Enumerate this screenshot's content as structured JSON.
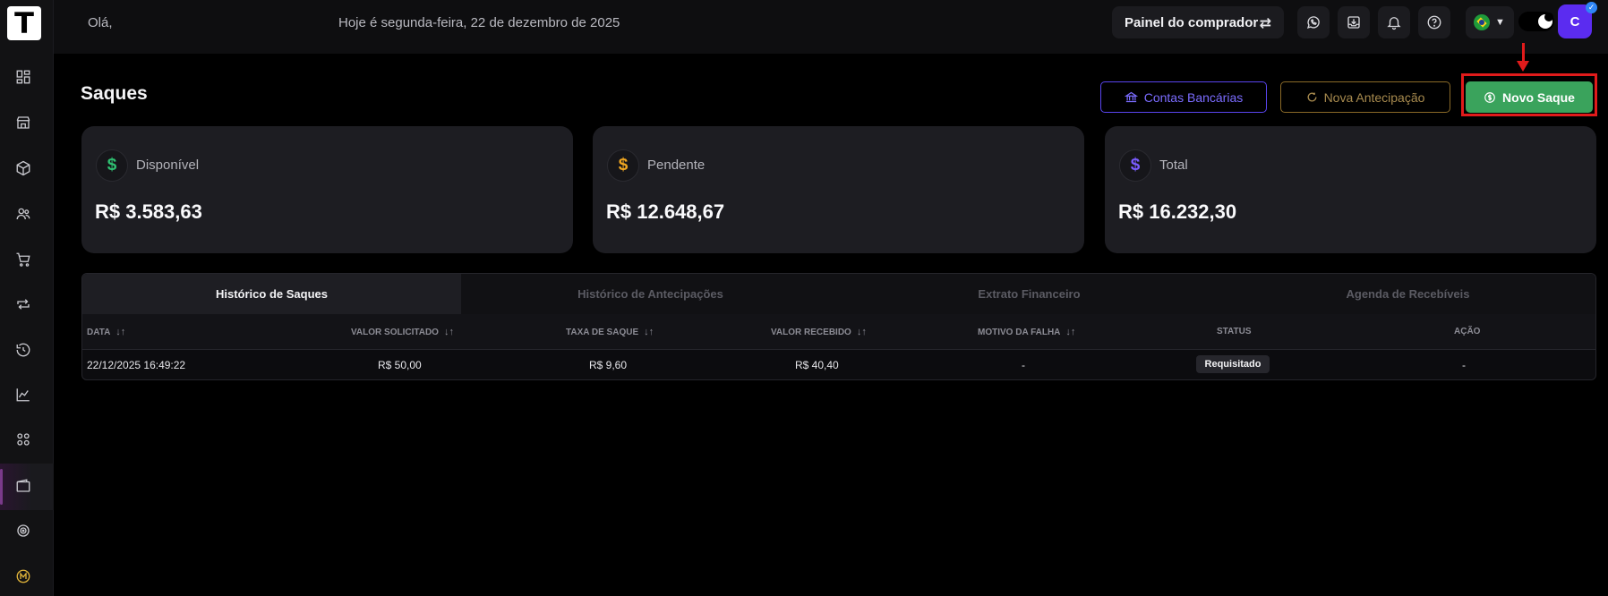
{
  "app": {
    "logo_letter": "T"
  },
  "topbar": {
    "greeting": "Olá,",
    "date_text": "Hoje é segunda-feira, 22 de dezembro de 2025",
    "buyer_panel_label": "Painel do comprador",
    "avatar_initial": "C"
  },
  "page": {
    "title": "Saques",
    "buttons": {
      "bank_accounts": "Contas Bancárias",
      "new_advance": "Nova Antecipação",
      "new_withdrawal": "Novo Saque"
    }
  },
  "cards": [
    {
      "label": "Disponível",
      "value": "R$ 3.583,63",
      "icon": "dollar-icon",
      "color": "#2fbf71"
    },
    {
      "label": "Pendente",
      "value": "R$ 12.648,67",
      "icon": "dollar-icon",
      "color": "#f0a621"
    },
    {
      "label": "Total",
      "value": "R$ 16.232,30",
      "icon": "dollar-icon",
      "color": "#7a5cff"
    }
  ],
  "tabs": [
    {
      "label": "Histórico de Saques",
      "active": true
    },
    {
      "label": "Histórico de Antecipações",
      "active": false
    },
    {
      "label": "Extrato Financeiro",
      "active": false
    },
    {
      "label": "Agenda de Recebíveis",
      "active": false
    }
  ],
  "table": {
    "columns": [
      "DATA",
      "VALOR SOLICITADO",
      "TAXA DE SAQUE",
      "VALOR RECEBIDO",
      "MOTIVO DA FALHA",
      "STATUS",
      "AÇÃO"
    ],
    "rows": [
      {
        "date": "22/12/2025 16:49:22",
        "requested": "R$ 50,00",
        "fee": "R$ 9,60",
        "received": "R$ 40,40",
        "failure_reason": "-",
        "status": "Requisitado",
        "action": "-"
      }
    ]
  },
  "colors": {
    "accent_green": "#3aa35c",
    "accent_purple": "#5a45f0",
    "accent_gold": "#8a6a28",
    "highlight_red": "#e11b1b"
  }
}
